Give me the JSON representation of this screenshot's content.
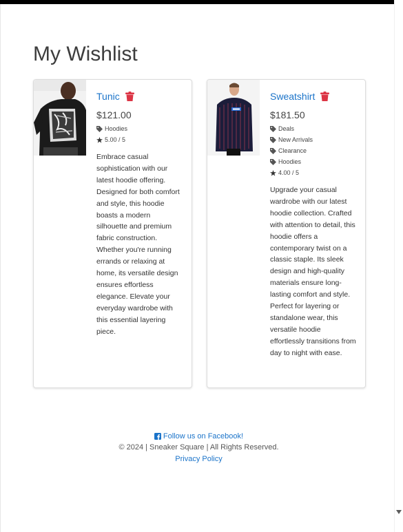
{
  "page": {
    "title": "My Wishlist"
  },
  "items": [
    {
      "name": "Tunic",
      "price": "$121.00",
      "tags": [
        "Hoodies"
      ],
      "rating": "5.00 / 5",
      "description": "Embrace casual sophistication with our latest hoodie offering. Designed for both comfort and style, this hoodie boasts a modern silhouette and premium fabric construction. Whether you're running errands or relaxing at home, its versatile design ensures effortless elegance. Elevate your everyday wardrobe with this essential layering piece."
    },
    {
      "name": "Sweatshirt",
      "price": "$181.50",
      "tags": [
        "Deals",
        "New Arrivals",
        "Clearance",
        "Hoodies"
      ],
      "rating": "4.00 / 5",
      "description": "Upgrade your casual wardrobe with our latest hoodie collection. Crafted with attention to detail, this hoodie offers a contemporary twist on a classic staple. Its sleek design and high-quality materials ensure long-lasting comfort and style. Perfect for layering or standalone wear, this versatile hoodie effortlessly transitions from day to night with ease."
    }
  ],
  "footer": {
    "facebook": "Follow us on Facebook!",
    "copyright": "© 2024 | Sneaker Square | All Rights Reserved.",
    "privacy": "Privacy Policy"
  },
  "colors": {
    "link": "#1a73c9",
    "delete": "#dc3545",
    "text": "#333333"
  },
  "icons": {
    "delete": "trash-icon",
    "tag": "tag-icon",
    "rating": "star-icon",
    "social": "facebook-icon"
  }
}
